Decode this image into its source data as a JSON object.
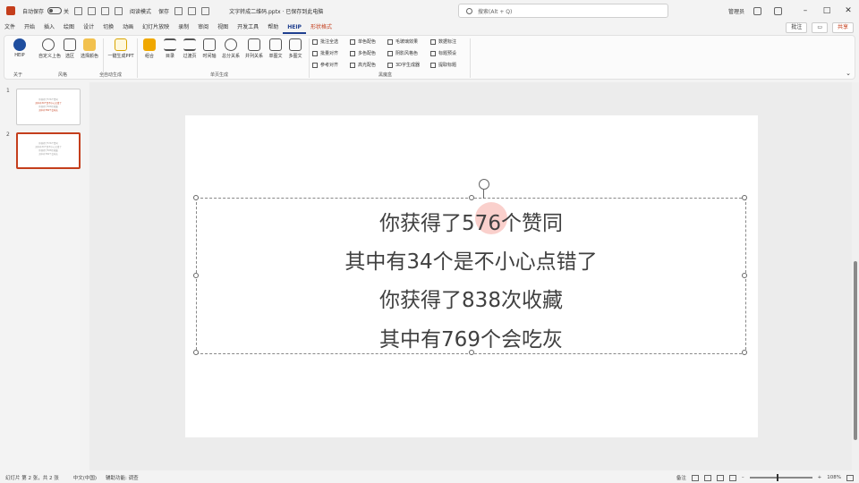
{
  "titlebar": {
    "autosave_label": "自动保存",
    "autosave_state": "关",
    "mode_label": "阅读模式",
    "save_label": "保存",
    "filename": "文字转成二维码.pptx · 已保存到此电脑",
    "search_placeholder": "搜索(Alt + Q)",
    "user": "管理员",
    "minimize": "–",
    "maximize": "□",
    "close": "✕"
  },
  "menu": {
    "tabs": [
      "文件",
      "开始",
      "插入",
      "绘图",
      "设计",
      "切换",
      "动画",
      "幻灯片放映",
      "录制",
      "审阅",
      "视图",
      "开发工具",
      "帮助",
      "HEIP",
      "形状格式"
    ],
    "active": "HEIP",
    "comments": "批注",
    "share": "共享"
  },
  "ribbon": {
    "buttons": [
      "HEIP",
      "自定义上色",
      "选区",
      "选择颜色",
      "一键生成PPT",
      "组合",
      "目录",
      "过渡页",
      "时间轴",
      "总分关系",
      "并列关系",
      "单图文",
      "多图文"
    ],
    "groups": [
      "关于",
      "风格",
      "全自动生成",
      "单页生成",
      "黑魔盒"
    ],
    "checkboxes": [
      "批注全选",
      "单色配色",
      "毛玻璃效果",
      "数据标注",
      "批量对齐",
      "多色配色",
      "阴影风格色",
      "标题预设",
      "参考对齐",
      "高光配色",
      "3D字生成器",
      "提取标题"
    ]
  },
  "thumbnails": {
    "slide1_num": "1",
    "slide2_num": "2",
    "slide1_lines": [
      "你获得了576个赞同",
      "其中有34个是不小心点错了",
      "你获得了838次收藏",
      "其中有769个会吃灰"
    ],
    "slide2_lines": [
      "你获得了576个赞同",
      "其中有34个是不小心点错了",
      "你获得了838次收藏",
      "其中有769个会吃灰"
    ]
  },
  "slide": {
    "lines": [
      "你获得了576个赞同",
      "其中有34个是不小心点错了",
      "你获得了838次收藏",
      "其中有769个会吃灰"
    ]
  },
  "status": {
    "slide_info": "幻灯片 第 2 张，共 2 张",
    "language": "中文(中国)",
    "accessibility": "辅助功能: 调查",
    "notes": "备注",
    "zoom": "108%"
  }
}
